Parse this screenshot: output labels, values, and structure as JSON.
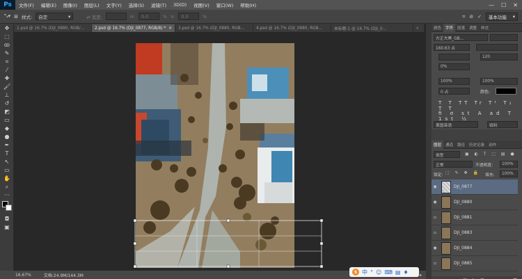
{
  "app": {
    "logo": "Ps"
  },
  "menu": [
    "文件(F)",
    "编辑(E)",
    "图像(I)",
    "图层(L)",
    "文字(Y)",
    "选择(S)",
    "滤镜(T)",
    "3D(D)",
    "视图(V)",
    "窗口(W)",
    "帮助(H)"
  ],
  "window_controls": [
    "—",
    "☐",
    "✕"
  ],
  "options": {
    "style_label": "样式:",
    "style_value": "自定",
    "h_label": "H:",
    "h_value": "0.0",
    "v_label": "V:",
    "v_value": "0.0",
    "percent": "%",
    "workspace": "基本功能"
  },
  "tabs": [
    {
      "label": "1.psd @ 16.7% (DJI_0880, RGB/...",
      "active": false
    },
    {
      "label": "2.psd @ 16.7% (DJI_0877, RGB/8) *",
      "active": true
    },
    {
      "label": "3.psd @ 16.7% (DJI_0880, RGB...",
      "active": false
    },
    {
      "label": "4.psd @ 16.7% (DJI_0880, RGB...",
      "active": false
    },
    {
      "label": "未标题-1 @ 16.7% (DJI_0...",
      "active": false
    }
  ],
  "status": {
    "zoom": "16.67%",
    "doc": "文档:24.9M/144.3M"
  },
  "ime": {
    "logo": "S",
    "items": [
      "中",
      "°",
      "☺",
      "⌨",
      "▤",
      "♦"
    ]
  },
  "character_panel": {
    "tabs": [
      "颜色",
      "字符",
      "段落",
      "调整",
      "样式"
    ],
    "font": "方正大黑_GB...",
    "size": "160.63 点",
    "tracking": "120",
    "scale": "0%",
    "v_scale": "100%",
    "h_scale": "100%",
    "baseline": "0 点",
    "color_label": "颜色:",
    "language": "美国英语",
    "aa": "锐利"
  },
  "layers_panel": {
    "tabs": [
      "图层",
      "通道",
      "路径",
      "历史记录",
      "动作"
    ],
    "kind": "类型",
    "blend": "正常",
    "opacity_label": "不透明度:",
    "opacity": "100%",
    "lock_label": "锁定:",
    "fill_label": "填充:",
    "fill": "100%",
    "layers": [
      {
        "name": "DJI_0877",
        "visible": true,
        "selected": true
      },
      {
        "name": "DJI_0880",
        "visible": true,
        "selected": false
      },
      {
        "name": "DJI_0881",
        "visible": false,
        "selected": false
      },
      {
        "name": "DJI_0883",
        "visible": false,
        "selected": false
      },
      {
        "name": "DJI_0884",
        "visible": true,
        "selected": false
      },
      {
        "name": "DJI_0885",
        "visible": false,
        "selected": false
      }
    ]
  }
}
